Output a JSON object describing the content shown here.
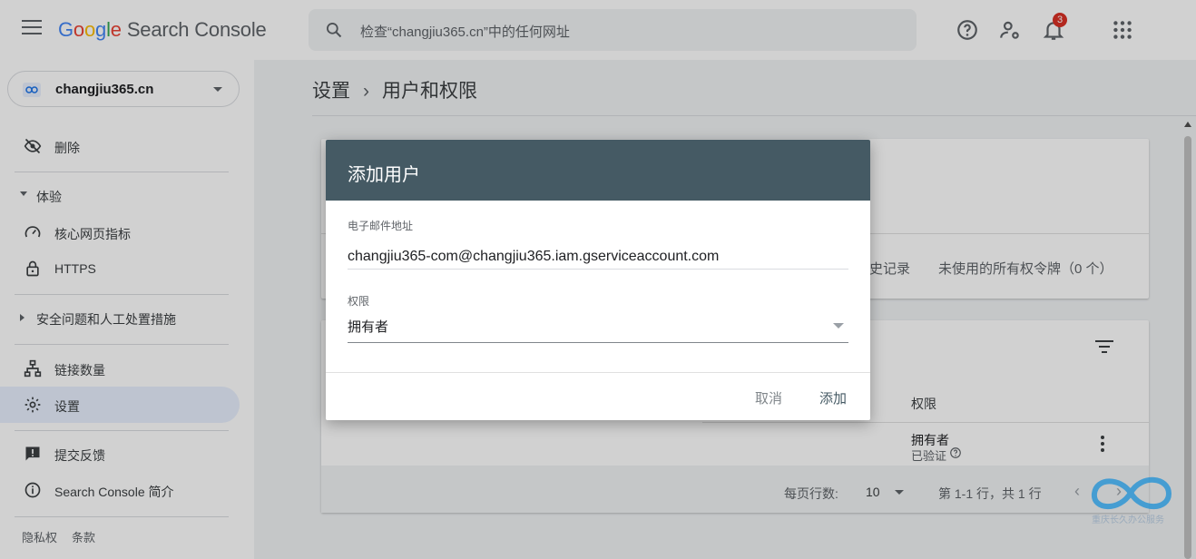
{
  "header": {
    "logo_letters": [
      "G",
      "o",
      "o",
      "g",
      "l",
      "e"
    ],
    "product": "Search Console",
    "search_placeholder": "检查“changjiu365.cn”中的任何网址",
    "notification_count": "3"
  },
  "sidebar": {
    "property": "changjiu365.cn",
    "items": [
      {
        "label": "删除",
        "icon": "eye-off-icon"
      },
      {
        "label": "核心网页指标",
        "icon": "gauge-icon"
      },
      {
        "label": "HTTPS",
        "icon": "lock-icon"
      },
      {
        "label": "链接数量",
        "icon": "sitemap-icon"
      },
      {
        "label": "设置",
        "icon": "gear-icon"
      },
      {
        "label": "提交反馈",
        "icon": "feedback-icon"
      },
      {
        "label": "Search Console 简介",
        "icon": "info-icon"
      }
    ],
    "sections": [
      {
        "label": "体验",
        "expanded": true
      },
      {
        "label": "安全问题和人工处置措施",
        "expanded": false
      }
    ],
    "footer": [
      "隐私权",
      "条款"
    ]
  },
  "breadcrumb": {
    "parent": "设置",
    "current": "用户和权限"
  },
  "background": {
    "history_partial": "史记录",
    "unused_tokens": "未使用的所有权令牌（0 个）",
    "permission_header": "权限",
    "user_permission": "拥有者",
    "user_status": "已验证",
    "rows_per_page_label": "每页行数:",
    "rows_per_page_value": "10",
    "range_text": "第 1-1 行，共 1 行"
  },
  "dialog": {
    "title": "添加用户",
    "email_label": "电子邮件地址",
    "email_value": "changjiu365-com@changjiu365.iam.gserviceaccount.com",
    "permission_label": "权限",
    "permission_value": "拥有者",
    "cancel_label": "取消",
    "add_label": "添加"
  },
  "watermark": "重庆长久办公服务",
  "colors": {
    "dialog_header": "#455a64",
    "badge": "#d93025",
    "active_nav": "#e8f0fe"
  }
}
